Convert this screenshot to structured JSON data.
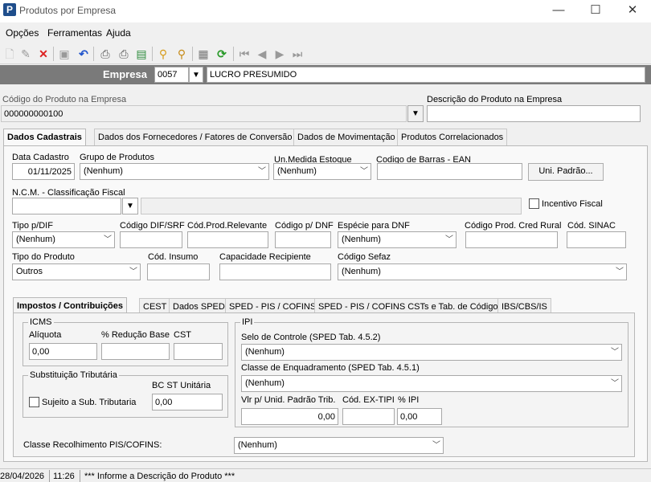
{
  "window": {
    "title": "Produtos por Empresa",
    "minimize": "—",
    "maximize": "☐",
    "close": "✕"
  },
  "menu": [
    "Opções",
    "Ferramentas",
    "Ajuda"
  ],
  "empresa": {
    "label": "Empresa",
    "code": "0057",
    "name": "LUCRO PRESUMIDO"
  },
  "produto": {
    "codigo_label": "Código do Produto na Empresa",
    "codigo_value": "000000000100",
    "descricao_label": "Descrição do Produto na Empresa",
    "descricao_value": ""
  },
  "main_tabs": [
    "Dados Cadastrais",
    "Dados dos Fornecedores / Fatores de Conversão",
    "Dados de Movimentação",
    "Produtos Correlacionados"
  ],
  "cadastro": {
    "data_cadastro_label": "Data Cadastro",
    "data_cadastro": "01/11/2025",
    "grupo_label": "Grupo de Produtos",
    "grupo": "(Nenhum)",
    "unidade_label": "Un.Medida Estoque",
    "unidade": "(Nenhum)",
    "ean_label": "Codigo de Barras - EAN",
    "ean": "",
    "uni_padrao_button": "Uni. Padrão...",
    "ncm_label": "N.C.M. -  Classificação Fiscal",
    "ncm": "",
    "ncm_desc": "",
    "incentivo_label": "Incentivo Fiscal",
    "tipo_dif_label": "Tipo p/DIF",
    "tipo_dif": "(Nenhum)",
    "cod_dif_label": "Código DIF/SRF",
    "cod_relevante_label": "Cód.Prod.Relevante",
    "cod_dnf_label": "Código p/ DNF",
    "especie_dnf_label": "Espécie para DNF",
    "especie_dnf": "(Nenhum)",
    "cred_rural_label": "Código Prod. Cred Rural",
    "sinac_label": "Cód. SINAC",
    "tipo_produto_label": "Tipo do Produto",
    "tipo_produto": "Outros",
    "insumo_label": "Cód. Insumo",
    "capacidade_label": "Capacidade Recipiente",
    "sefaz_label": "Código Sefaz",
    "sefaz": "(Nenhum)"
  },
  "sub_tabs": [
    "Impostos / Contribuições",
    "CEST",
    "Dados SPED",
    "SPED - PIS / COFINS",
    "SPED - PIS / COFINS CSTs e Tab. de Códigos",
    "IBS/CBS/IS"
  ],
  "icms": {
    "group_label": "ICMS",
    "aliquota_label": "Alíquota",
    "aliquota": "0,00",
    "reducao_label": "% Redução Base",
    "reducao": "",
    "cst_label": "CST",
    "cst": ""
  },
  "subst": {
    "group_label": "Substituição Tributária",
    "bc_label": "BC ST Unitária",
    "bc": "0,00",
    "sujeito_label": "Sujeito a Sub. Tributaria"
  },
  "ipi": {
    "group_label": "IPI",
    "selo_label": "Selo de Controle (SPED Tab. 4.5.2)",
    "selo": "(Nenhum)",
    "classe_label": "Classe de Enquadramento (SPED Tab. 4.5.1)",
    "classe": "(Nenhum)",
    "vlr_label": "Vlr p/ Unid. Padrão Trib.",
    "vlr": "0,00",
    "extipi_label": "Cód. EX-TIPI",
    "extipi": "",
    "pct_label": "% IPI",
    "pct": "0,00"
  },
  "pis": {
    "label": "Classe Recolhimento PIS/COFINS:",
    "value": "(Nenhum)"
  },
  "status": {
    "date": "28/04/2026",
    "time": "11:26",
    "message": "*** Informe a Descrição do Produto ***"
  }
}
